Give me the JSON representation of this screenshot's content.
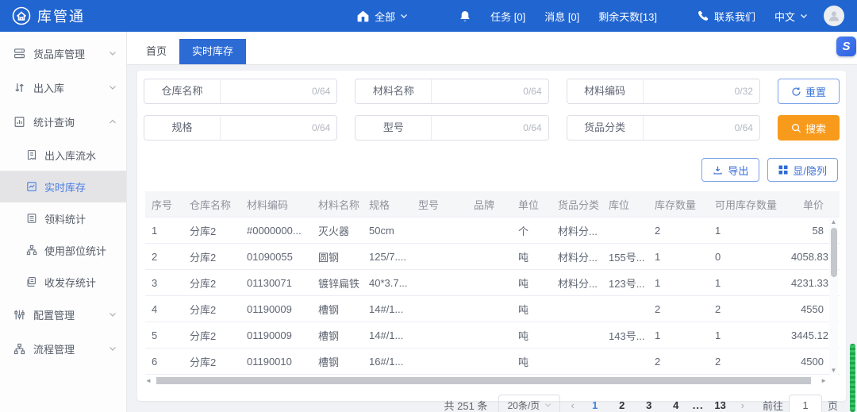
{
  "colors": {
    "topbar_blue": "#2165d0",
    "primary_blue": "#3e77d8",
    "tab_active_blue": "#2d6bd4",
    "search_orange": "#f89a1c",
    "scrollbar_green": "#1fa44a",
    "sidebar_active_bg": "#e4e4e7"
  },
  "topbar": {
    "logo_text": "库管通",
    "scope_label": "全部",
    "tasks_label": "任务 [0]",
    "messages_label": "消息 [0]",
    "days_left_label": "剩余天数[13]",
    "contact_label": "联系我们",
    "language_label": "中文"
  },
  "sidebar": {
    "items": [
      {
        "label": "货品库管理"
      },
      {
        "label": "出入库"
      },
      {
        "label": "统计查询"
      },
      {
        "label": "出入库流水"
      },
      {
        "label": "实时库存"
      },
      {
        "label": "领料统计"
      },
      {
        "label": "使用部位统计"
      },
      {
        "label": "收发存统计"
      },
      {
        "label": "配置管理"
      },
      {
        "label": "流程管理"
      }
    ]
  },
  "tabs": [
    {
      "label": "首页"
    },
    {
      "label": "实时库存"
    }
  ],
  "float_badge_label": "S",
  "search": {
    "fields": [
      {
        "label": "仓库名称",
        "counter": "0/64"
      },
      {
        "label": "材料名称",
        "counter": "0/64"
      },
      {
        "label": "材料编码",
        "counter": "0/32"
      },
      {
        "label": "规格",
        "counter": "0/64"
      },
      {
        "label": "型号",
        "counter": "0/64"
      },
      {
        "label": "货品分类",
        "counter": "0/64"
      }
    ],
    "reset_label": "重置",
    "search_label": "搜索"
  },
  "toolbar": {
    "export_label": "导出",
    "columns_label": "显/隐列"
  },
  "table": {
    "headers": [
      "序号",
      "仓库名称",
      "材料编码",
      "材料名称",
      "规格",
      "型号",
      "品牌",
      "单位",
      "货品分类",
      "库位",
      "库存数量",
      "可用库存数量",
      "单价"
    ],
    "rows": [
      [
        "1",
        "分库2",
        "#0000000...",
        "灭火器",
        "50cm",
        "",
        "",
        "个",
        "材料分...",
        "",
        "2",
        "1",
        "58"
      ],
      [
        "2",
        "分库2",
        "01090055",
        "圆钢",
        "125/7....",
        "",
        "",
        "吨",
        "材料分...",
        "155号...",
        "1",
        "0",
        "4058.83"
      ],
      [
        "3",
        "分库2",
        "01130071",
        "镀锌扁铁",
        "40*3.7...",
        "",
        "",
        "吨",
        "材料分...",
        "123号...",
        "1",
        "1",
        "4231.33"
      ],
      [
        "4",
        "分库2",
        "01190009",
        "槽钢",
        "14#/1...",
        "",
        "",
        "吨",
        "",
        "",
        "2",
        "2",
        "4550"
      ],
      [
        "5",
        "分库2",
        "01190009",
        "槽钢",
        "14#/1...",
        "",
        "",
        "吨",
        "",
        "143号...",
        "1",
        "1",
        "3445.12"
      ],
      [
        "6",
        "分库2",
        "01190010",
        "槽钢",
        "16#/1...",
        "",
        "",
        "吨",
        "",
        "",
        "2",
        "2",
        "4500"
      ]
    ]
  },
  "pagination": {
    "total_label": "共 251 条",
    "page_size_label": "20条/页",
    "pages": [
      "1",
      "2",
      "3",
      "4",
      "...",
      "13"
    ],
    "goto_label": "前往",
    "goto_value": "1",
    "goto_suffix": "页"
  }
}
